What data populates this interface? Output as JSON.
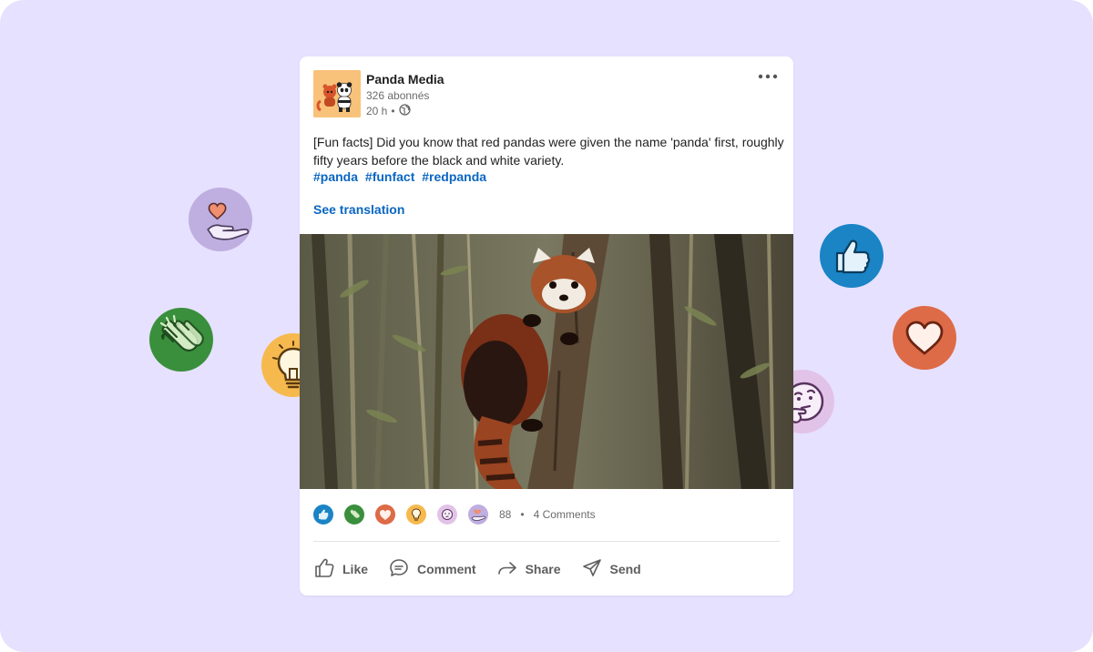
{
  "post": {
    "author": "Panda Media",
    "followers": "326 abonnés",
    "time": "20 h",
    "time_separator": "•",
    "text": "[Fun facts] Did you know that red pandas were given the name 'panda' first, roughly fifty years before the black and white variety.",
    "hashtags": [
      "#panda",
      "#funfact",
      "#redpanda"
    ],
    "see_translation": "See translation",
    "photo_icon": "red-panda-photo"
  },
  "reactions": {
    "icons": [
      "like-icon",
      "celebrate-icon",
      "love-icon",
      "insightful-icon",
      "curious-icon",
      "support-icon"
    ],
    "count": "88",
    "separator": "•",
    "comments": "4 Comments"
  },
  "actions": {
    "like": "Like",
    "comment": "Comment",
    "share": "Share",
    "send": "Send"
  },
  "colors": {
    "background": "#e6e1fe",
    "link": "#0a66c2",
    "like": "#1a84c5",
    "celebrate": "#3a8f3c",
    "love": "#dd6b47",
    "insightful": "#f6b94e",
    "curious": "#e2c3e8",
    "support": "#bfaee0"
  }
}
